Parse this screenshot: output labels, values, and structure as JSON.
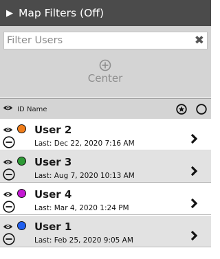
{
  "header": {
    "toggle_icon": "triangle-right-icon",
    "title": "Map Filters (Off)"
  },
  "filter": {
    "search_placeholder": "Filter Users",
    "clear_icon": "close-icon",
    "center_label": "Center",
    "center_icon": "circled-plus-icon"
  },
  "columns": {
    "visibility_icon": "eye-icon",
    "id_label": "ID",
    "name_label": "Name",
    "star_icon": "circled-star-icon",
    "circle_icon": "circle-icon"
  },
  "users": [
    {
      "name": "User 2",
      "last": "Last: Dec 22, 2020 7:16 AM",
      "color": "#f07d1a"
    },
    {
      "name": "User 3",
      "last": "Last: Aug 7, 2020 10:13 AM",
      "color": "#2e9a36"
    },
    {
      "name": "User 4",
      "last": "Last: Mar 4, 2020 1:24 PM",
      "color": "#c419d3"
    },
    {
      "name": "User 1",
      "last": "Last: Feb 25, 2020 9:05 AM",
      "color": "#2160f0"
    }
  ],
  "row_backgrounds": [
    "#ffffff",
    "#e2e2e2",
    "#ffffff",
    "#e2e2e2"
  ]
}
